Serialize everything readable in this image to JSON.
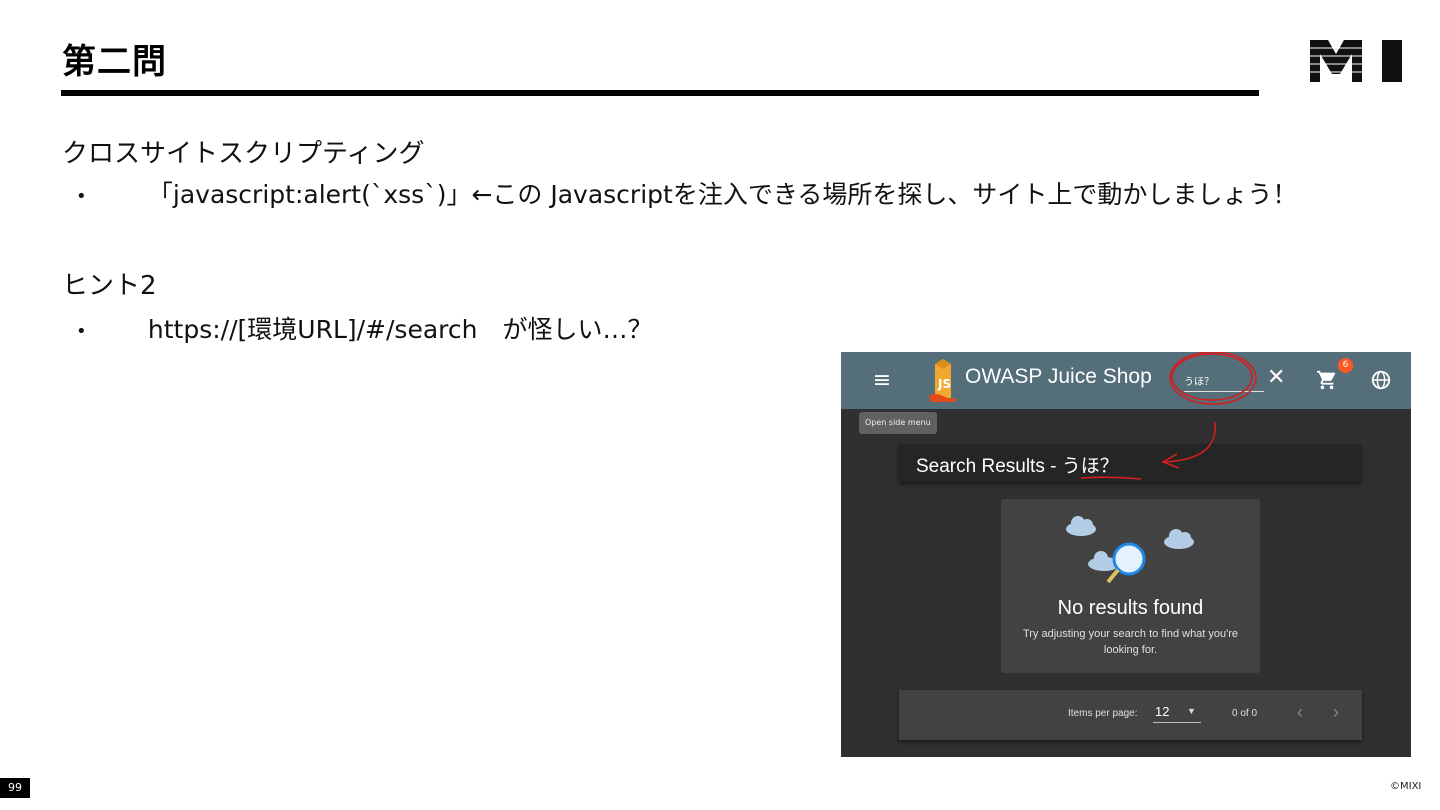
{
  "slide": {
    "title": "第二問",
    "section1_heading": "クロスサイトスクリプティング",
    "bullet1": "「javascript:alert(`xss`)」←この Javascriptを注入できる場所を探し、サイト上で動かしましょう！",
    "section2_heading": "ヒント2",
    "bullet2": "https://[環境URL]/#/search　が怪しい…？",
    "page_number": "99",
    "copyright": "©MIXI",
    "bullet_glyph": "•"
  },
  "app": {
    "title": "OWASP Juice Shop",
    "menu_icon": "≡",
    "search_value": "うほ？",
    "clear_icon": "✕",
    "cart_count": "6",
    "tooltip": "Open side menu",
    "results_title": "Search Results - うほ？",
    "empty_title": "No results found",
    "empty_subtitle": "Try adjusting your search to find what you're looking for.",
    "items_per_page_label": "Items per page:",
    "items_per_page_value": "12",
    "dropdown_icon": "▼",
    "range_label": "0 of 0",
    "prev_icon": "‹",
    "next_icon": "›"
  },
  "colors": {
    "toolbar": "#546e7a",
    "background": "#303030",
    "card": "#424242",
    "badge": "#ff5722",
    "annotation": "#d21f1f"
  }
}
